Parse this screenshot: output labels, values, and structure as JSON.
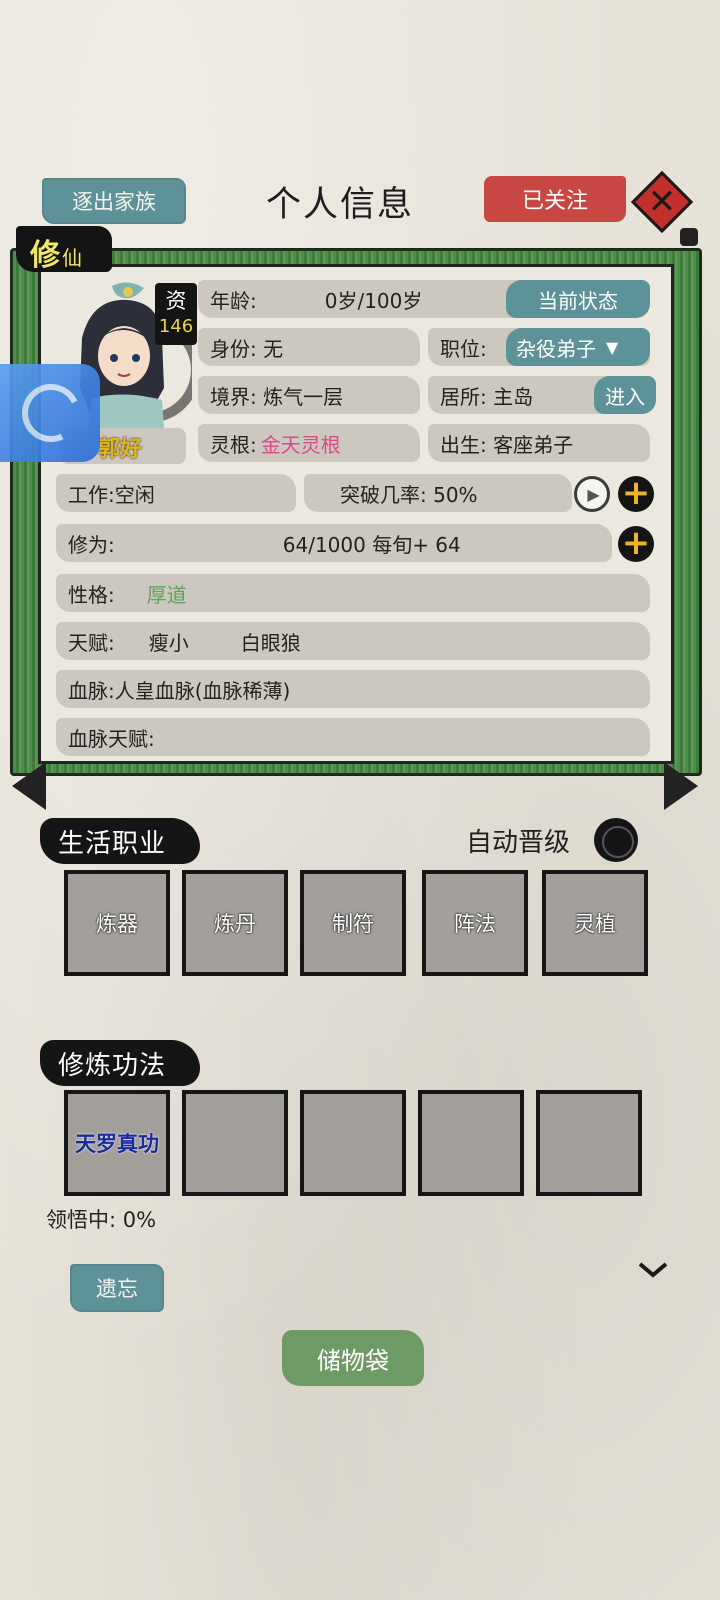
{
  "header": {
    "expel_label": "逐出家族",
    "title": "个人信息",
    "followed_label": "已关注",
    "close_glyph": "✕"
  },
  "badge": {
    "big": "修",
    "small": "仙"
  },
  "avatar": {
    "qualification_label": "资",
    "qualification_value": "146",
    "name": "郭好"
  },
  "info": {
    "age_label": "年龄:",
    "age_value": "0岁/100岁",
    "current_state_button": "当前状态",
    "identity": "身份: 无",
    "position_label": "职位:",
    "position_value": "杂役弟子",
    "realm": "境界: 炼气一层",
    "residence": "居所: 主岛",
    "enter_button": "进入",
    "root_label": "灵根:",
    "root_value": "金天灵根",
    "birth": "出生: 客座弟子",
    "work": "工作:空闲",
    "breakthrough": "突破几率: 50%",
    "cultivation_label": "修为:",
    "cultivation_value": "64/1000  每旬+ 64",
    "personality_label": "性格:",
    "personality_value": "厚道",
    "talent_label": "天赋:",
    "talent_1": "瘦小",
    "talent_2": "白眼狼",
    "bloodline": "血脉:人皇血脉(血脉稀薄)",
    "bloodline_talent": "血脉天赋:"
  },
  "colors": {
    "teal": "#5e9299",
    "red": "#c94742",
    "green_frame": "#4e8d4c",
    "pink": "#d94a8a",
    "gold": "#e6b41e"
  },
  "life_jobs": {
    "header": "生活职业",
    "auto_upgrade_label": "自动晋级",
    "slots": [
      "炼器",
      "炼丹",
      "制符",
      "阵法",
      "灵植"
    ]
  },
  "techniques": {
    "header": "修炼功法",
    "slots": [
      "天罗真功",
      "",
      "",
      "",
      ""
    ],
    "comprehension": "领悟中:  0%"
  },
  "footer": {
    "forget_button": "遗忘",
    "bag_button": "储物袋"
  }
}
